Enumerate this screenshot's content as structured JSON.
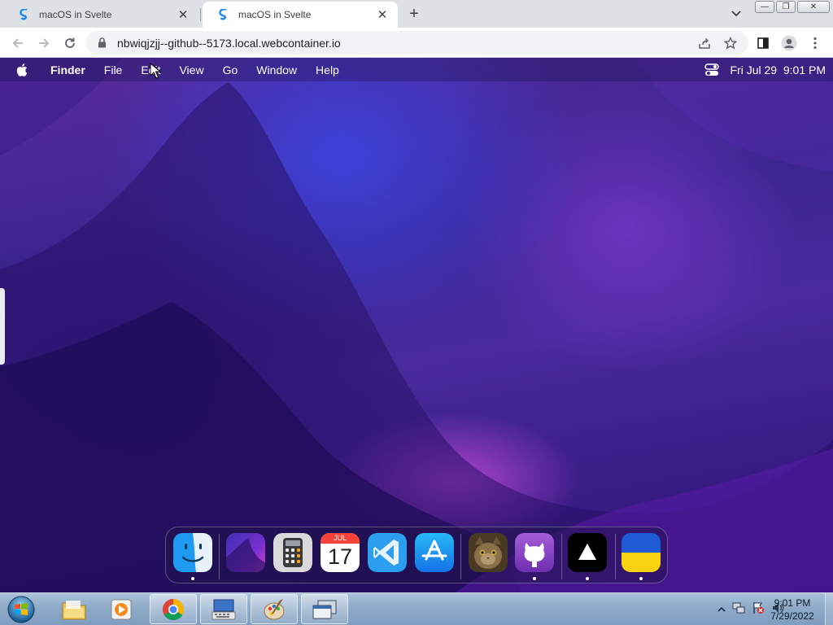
{
  "browser": {
    "tabs": [
      {
        "title": "macOS in Svelte",
        "active": false
      },
      {
        "title": "macOS in Svelte",
        "active": true
      }
    ],
    "url": "nbwiqjzjj--github--5173.local.webcontainer.io"
  },
  "macos": {
    "menubar": {
      "items": [
        "Finder",
        "File",
        "Edit",
        "View",
        "Go",
        "Window",
        "Help"
      ],
      "datetime": "Fri Jul 29  9:01 PM"
    },
    "dock": {
      "apps": [
        {
          "name": "Finder",
          "icon": "finder-icon",
          "running": true
        },
        {
          "name": "Wallpapers",
          "icon": "wallpapers-icon",
          "running": false
        },
        {
          "name": "Calculator",
          "icon": "calculator-icon",
          "running": false
        },
        {
          "name": "Calendar",
          "icon": "calendar-icon",
          "running": false,
          "month": "JUL",
          "day": "17"
        },
        {
          "name": "VS Code",
          "icon": "vscode-icon",
          "running": false
        },
        {
          "name": "App Store",
          "icon": "appstore-icon",
          "running": false
        },
        {
          "name": "Cat",
          "icon": "cat-icon",
          "running": false
        },
        {
          "name": "GitHub",
          "icon": "github-icon",
          "running": true
        },
        {
          "name": "Vercel",
          "icon": "vercel-icon",
          "running": true
        },
        {
          "name": "Ukraine",
          "icon": "ukraine-flag-icon",
          "running": true
        }
      ]
    }
  },
  "taskbar": {
    "clock_time": "9:01 PM",
    "clock_date": "7/29/2022"
  },
  "colors": {
    "accent": "#1a73e8",
    "menubar_text": "#ffffff",
    "taskbar": "#8eaac8"
  }
}
